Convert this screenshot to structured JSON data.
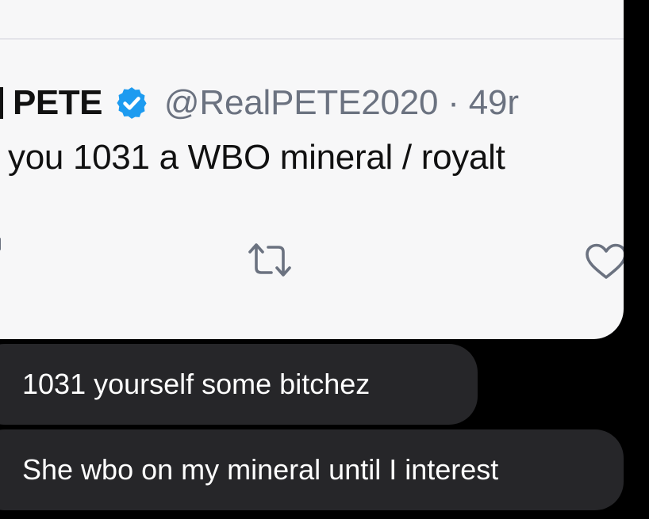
{
  "tweet": {
    "display_name": "PETE",
    "handle_time": "@RealPETE2020 · 49r",
    "text": "you 1031 a WBO mineral / royalt",
    "icons": {
      "verified": "verified-badge-icon",
      "retweet": "retweet-icon",
      "like": "heart-icon"
    },
    "colors": {
      "card_bg": "#f7f7f8",
      "verified_blue": "#1d9bf0",
      "secondary_text": "#6b7280"
    }
  },
  "messages": [
    {
      "text": "1031 yourself some bitchez"
    },
    {
      "text": "She wbo on my mineral until I interest"
    }
  ],
  "colors": {
    "background": "#000000",
    "bubble": "#262629",
    "bubble_text": "#ffffff"
  }
}
